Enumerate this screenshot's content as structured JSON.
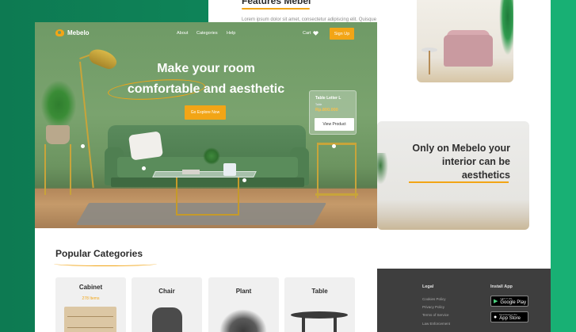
{
  "back_page": {
    "title": "Features Mebel",
    "body_text": "Lorem ipsum dolor sit amet, consectetur adipiscing elit. Quisque viverra",
    "promo_text": "Only on Mebelo your interior can be aesthetics"
  },
  "footer": {
    "legal_heading": "Legal",
    "legal_links": [
      "Cookies Policy",
      "Privacy Policy",
      "Terms of Service",
      "Law Enforcement"
    ],
    "install_heading": "Install App",
    "google_play": {
      "small": "GET IT ON",
      "big": "Google Play"
    },
    "app_store": {
      "small": "Download on the",
      "big": "App Store"
    }
  },
  "nav": {
    "logo": "Mebelo",
    "links": [
      "About",
      "Categories",
      "Help"
    ],
    "cart": "Cart",
    "signup": "Sign Up"
  },
  "hero": {
    "title_line1": "Make your room",
    "title_line2": "comfortable and aesthetic",
    "cta": "Go Explore Now"
  },
  "product_card": {
    "name": "Table Letter L",
    "meta": "Table",
    "price": "Rp.800.000",
    "button": "View Product"
  },
  "categories": {
    "title": "Popular Categories",
    "items": [
      {
        "name": "Cabinet",
        "count": "278 Items"
      },
      {
        "name": "Chair"
      },
      {
        "name": "Plant"
      },
      {
        "name": "Table"
      }
    ]
  },
  "colors": {
    "accent": "#f2a516",
    "brand_green": "#0f8a5c",
    "footer_bg": "#3e3e3e"
  }
}
